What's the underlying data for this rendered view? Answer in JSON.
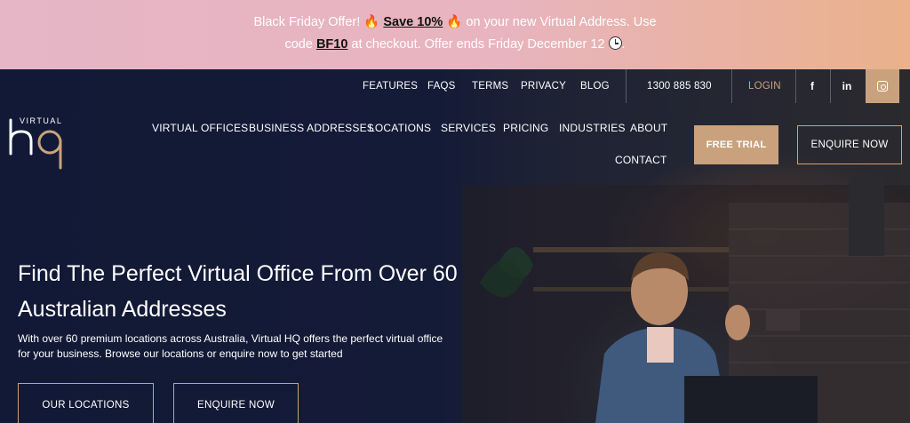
{
  "promo": {
    "text_1": "Black Friday Offer! ",
    "fire_icon": "🔥",
    "save_link": "Save 10%",
    "text_2": " on your new Virtual Address. Use",
    "text_3": "code ",
    "code": "BF10",
    "text_4": " at checkout. Offer ends Friday December 12 ",
    "text_5": "."
  },
  "topnav": {
    "links": [
      "FEATURES",
      "FAQS",
      "TERMS",
      "PRIVACY",
      "BLOG"
    ],
    "phone": "1300 885 830",
    "login": "LOGIN",
    "social": {
      "facebook": "f",
      "linkedin": "in"
    }
  },
  "logo": {
    "word": "VIRTUAL"
  },
  "mainnav": {
    "items": [
      "VIRTUAL OFFICES",
      "BUSINESS ADDRESSES",
      "LOCATIONS",
      "SERVICES",
      "PRICING",
      "INDUSTRIES",
      "ABOUT",
      "CONTACT"
    ],
    "free_trial": "FREE TRIAL",
    "enquire": "ENQUIRE NOW"
  },
  "hero": {
    "headline": "Find The Perfect Virtual Office From Over 60 Australian Addresses",
    "subtext": "With over 60 premium locations across Australia, Virtual HQ offers the perfect virtual office for your business. Browse our locations or enquire now to get started",
    "btn_locations": "OUR LOCATIONS",
    "btn_enquire": "ENQUIRE NOW"
  },
  "colors": {
    "accent": "#c9a27d",
    "navy": "#141a33"
  }
}
